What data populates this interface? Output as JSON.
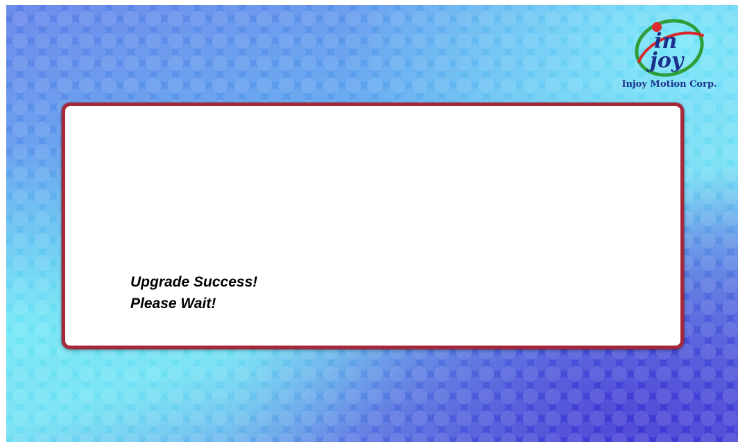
{
  "logo": {
    "icon": "injoy-logo-icon",
    "mark_text": [
      "in",
      "joy"
    ],
    "caption": "Injoy Motion Corp.",
    "colors": {
      "ring_green": "#2e9e3a",
      "ring_red": "#d8282e",
      "text_blue": "#1c2f8a"
    }
  },
  "dialog": {
    "border_color": "#a4283a",
    "lines": [
      "Upgrade Success!",
      "Please Wait!"
    ]
  }
}
